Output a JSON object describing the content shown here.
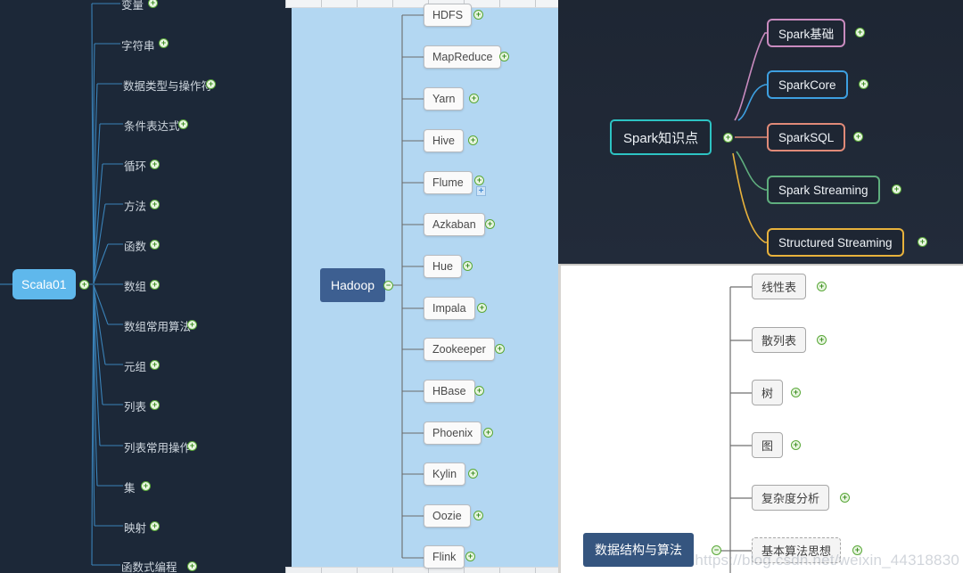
{
  "watermark": "https://blog.csdn.net/weixin_44318830",
  "panels": {
    "scala": {
      "root": {
        "label": "Scala01",
        "color": "#5fb8ec"
      },
      "branch_color": "#3a82b8",
      "background": "#1c2838",
      "children": [
        {
          "label": "变量",
          "badge": "plus"
        },
        {
          "label": "字符串",
          "badge": "plus"
        },
        {
          "label": "数据类型与操作符",
          "badge": "plus"
        },
        {
          "label": "条件表达式",
          "badge": "plus"
        },
        {
          "label": "循环",
          "badge": "plus"
        },
        {
          "label": "方法",
          "badge": "plus"
        },
        {
          "label": "函数",
          "badge": "plus"
        },
        {
          "label": "数组",
          "badge": "plus"
        },
        {
          "label": "数组常用算法",
          "badge": "plus"
        },
        {
          "label": "元组",
          "badge": "plus"
        },
        {
          "label": "列表",
          "badge": "plus"
        },
        {
          "label": "列表常用操作",
          "badge": "plus"
        },
        {
          "label": "集",
          "badge": "plus"
        },
        {
          "label": "映射",
          "badge": "plus"
        },
        {
          "label": "函数式编程",
          "badge": "plus"
        }
      ]
    },
    "hadoop": {
      "root": {
        "label": "Hadoop",
        "color": "#3d5f91",
        "badge": "minus"
      },
      "background": "#b3d7f2",
      "children": [
        {
          "label": "HDFS",
          "badge": "plus"
        },
        {
          "label": "MapReduce",
          "badge": "plus"
        },
        {
          "label": "Yarn",
          "badge": "plus"
        },
        {
          "label": "Hive",
          "badge": "plus"
        },
        {
          "label": "Flume",
          "badge": "plus",
          "extra_badge": "blue-plus"
        },
        {
          "label": "Azkaban",
          "badge": "plus"
        },
        {
          "label": "Hue",
          "badge": "plus"
        },
        {
          "label": "Impala",
          "badge": "plus"
        },
        {
          "label": "Zookeeper",
          "badge": "plus"
        },
        {
          "label": "HBase",
          "badge": "plus"
        },
        {
          "label": "Phoenix",
          "badge": "plus"
        },
        {
          "label": "Kylin",
          "badge": "plus"
        },
        {
          "label": "Oozie",
          "badge": "plus"
        },
        {
          "label": "Flink",
          "badge": "plus"
        }
      ]
    },
    "spark": {
      "root": {
        "label": "Spark知识点",
        "border_color": "#2dc3c3",
        "badge": "plus"
      },
      "background": "#1e2633",
      "children": [
        {
          "label": "Spark基础",
          "border_color": "#c98bbf",
          "badge": "plus"
        },
        {
          "label": "SparkCore",
          "border_color": "#3d9fe0",
          "badge": "plus"
        },
        {
          "label": "SparkSQL",
          "border_color": "#e08a78",
          "badge": "plus"
        },
        {
          "label": "Spark Streaming",
          "border_color": "#5fae7e",
          "badge": "plus"
        },
        {
          "label": "Structured Streaming",
          "border_color": "#e8b23c",
          "badge": "plus"
        }
      ]
    },
    "datastructure": {
      "root": {
        "label": "数据结构与算法",
        "color": "#35557f",
        "badge": "minus"
      },
      "background": "#ffffff",
      "children": [
        {
          "label": "线性表",
          "badge": "plus"
        },
        {
          "label": "散列表",
          "badge": "plus"
        },
        {
          "label": "树",
          "badge": "plus"
        },
        {
          "label": "图",
          "badge": "plus"
        },
        {
          "label": "复杂度分析",
          "badge": "plus"
        },
        {
          "label": "基本算法思想",
          "badge": "plus"
        }
      ]
    }
  }
}
